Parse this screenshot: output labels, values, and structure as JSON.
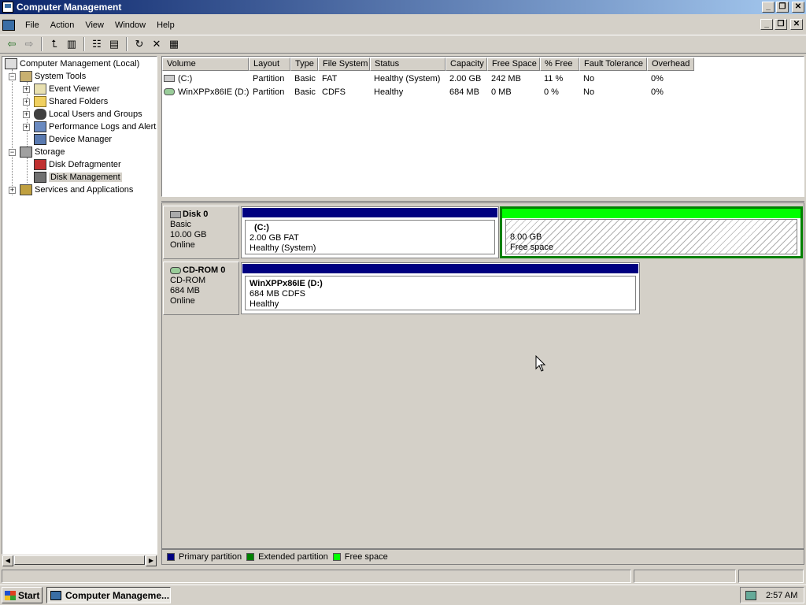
{
  "window": {
    "title": "Computer Management"
  },
  "menu": [
    "File",
    "Action",
    "View",
    "Window",
    "Help"
  ],
  "toolbar": {
    "icons": [
      "back-icon",
      "forward-icon",
      "up-folder-icon",
      "show-hide-tree-icon",
      "properties-icon",
      "help-icon",
      "refresh-icon",
      "delete-icon",
      "export-icon"
    ]
  },
  "tree": {
    "root": "Computer Management (Local)",
    "system_tools": "System Tools",
    "event_viewer": "Event Viewer",
    "shared_folders": "Shared Folders",
    "local_users": "Local Users and Groups",
    "perf_logs": "Performance Logs and Alerts",
    "device_manager": "Device Manager",
    "storage": "Storage",
    "disk_defrag": "Disk Defragmenter",
    "disk_mgmt": "Disk Management",
    "services": "Services and Applications"
  },
  "volume_list": {
    "columns": [
      "Volume",
      "Layout",
      "Type",
      "File System",
      "Status",
      "Capacity",
      "Free Space",
      "% Free",
      "Fault Tolerance",
      "Overhead"
    ],
    "rows": [
      {
        "volume": "(C:)",
        "layout": "Partition",
        "type": "Basic",
        "fs": "FAT",
        "status": "Healthy (System)",
        "capacity": "2.00 GB",
        "free": "242 MB",
        "pct": "11 %",
        "ft": "No",
        "overhead": "0%"
      },
      {
        "volume": "WinXPPx86IE (D:)",
        "layout": "Partition",
        "type": "Basic",
        "fs": "CDFS",
        "status": "Healthy",
        "capacity": "684 MB",
        "free": "0 MB",
        "pct": "0 %",
        "ft": "No",
        "overhead": "0%"
      }
    ]
  },
  "disks": {
    "disk0": {
      "name": "Disk 0",
      "type": "Basic",
      "size": "10.00 GB",
      "state": "Online",
      "c": {
        "title": "(C:)",
        "line2": "2.00 GB FAT",
        "line3": "Healthy (System)"
      },
      "free": {
        "line1": "8.00 GB",
        "line2": "Free space"
      }
    },
    "cdrom0": {
      "name": "CD-ROM 0",
      "type": "CD-ROM",
      "size": "684 MB",
      "state": "Online",
      "d": {
        "title": "WinXPPx86IE  (D:)",
        "line2": "684 MB CDFS",
        "line3": "Healthy"
      }
    }
  },
  "legend": {
    "primary": "Primary partition",
    "extended": "Extended partition",
    "free": "Free space"
  },
  "colors": {
    "primary": "#000080",
    "extended": "#008000",
    "free": "#00ff00"
  },
  "taskbar": {
    "start": "Start",
    "task": "Computer Manageme...",
    "clock": "2:57 AM"
  }
}
